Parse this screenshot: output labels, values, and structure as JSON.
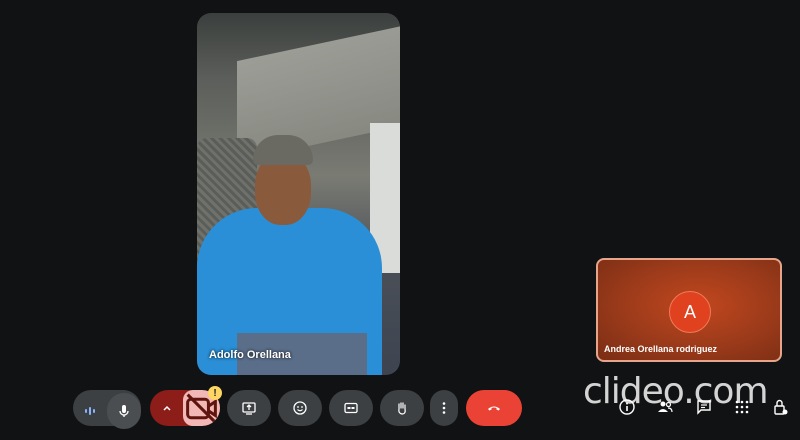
{
  "main_tile": {
    "participant_name": "Adolfo Orellana"
  },
  "side_tile": {
    "avatar_initial": "A",
    "participant_name": "Andrea Orellana rodriguez"
  },
  "controls": {
    "warning_badge": "!",
    "icons": [
      "audio-levels-icon",
      "mic-icon",
      "chevron-up-icon",
      "camera-off-icon",
      "present-screen-icon",
      "emoji-icon",
      "captions-icon",
      "raise-hand-icon",
      "more-options-icon",
      "end-call-icon"
    ]
  },
  "right_icons": [
    "info-icon",
    "people-icon",
    "chat-icon",
    "activities-icon",
    "host-controls-icon"
  ],
  "watermark": "clideo.com",
  "colors": {
    "background": "#111213",
    "control_bg": "#3c4043",
    "end_call": "#ea4335",
    "camera_off_bg": "#8c1d18",
    "avatar": "#e0411f"
  }
}
